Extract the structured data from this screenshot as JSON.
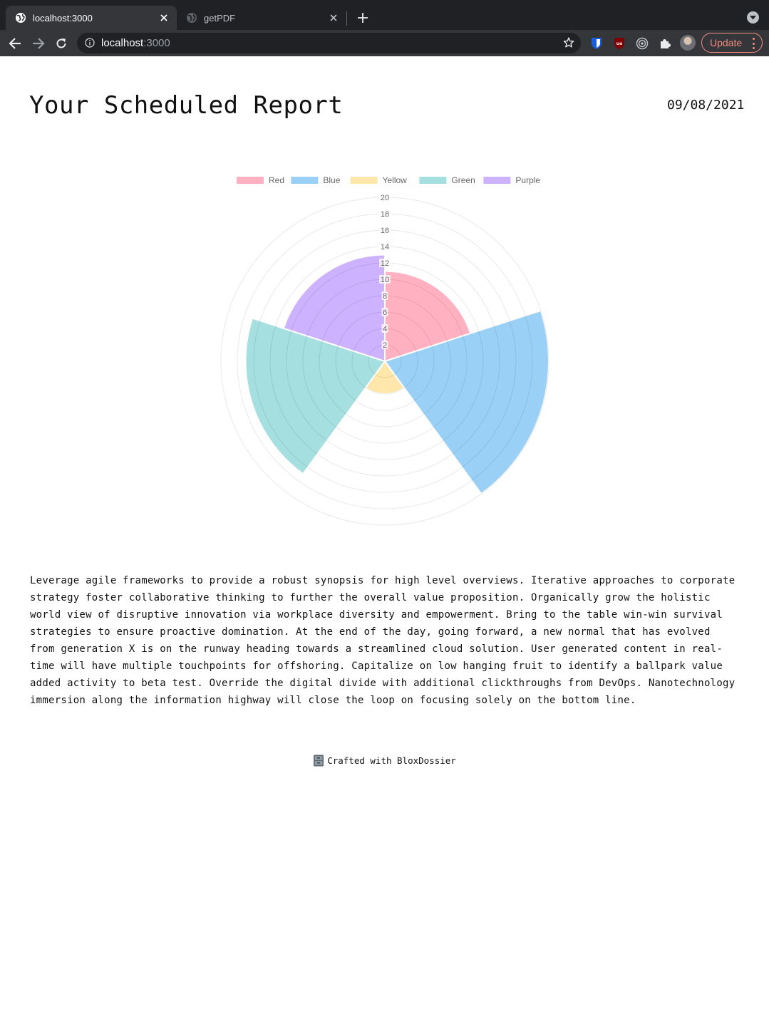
{
  "browser": {
    "tabs": [
      {
        "title": "localhost:3000",
        "active": true
      },
      {
        "title": "getPDF",
        "active": false
      }
    ],
    "url_host": "localhost",
    "url_port": ":3000",
    "update_label": "Update",
    "extensions": [
      "bitwarden-icon",
      "ublock-icon",
      "target-icon",
      "puzzle-icon"
    ]
  },
  "report": {
    "title": "Your Scheduled Report",
    "date": "09/08/2021",
    "body": "Leverage agile frameworks to provide a robust synopsis for high level overviews. Iterative approaches to corporate strategy foster collaborative thinking to further the overall value proposition. Organically grow the holistic world view of disruptive innovation via workplace diversity and empowerment. Bring to the table win-win survival strategies to ensure proactive domination. At the end of the day, going forward, a new normal that has evolved from generation X is on the runway heading towards a streamlined cloud solution. User generated content in real-time will have multiple touchpoints for offshoring. Capitalize on low hanging fruit to identify a ballpark value added activity to beta test. Override the digital divide with additional clickthroughs from DevOps. Nanotechnology immersion along the information highway will close the loop on focusing solely on the bottom line.",
    "footer": "Crafted with BloxDossier"
  },
  "chart_data": {
    "type": "polarArea",
    "categories": [
      "Red",
      "Blue",
      "Yellow",
      "Green",
      "Purple"
    ],
    "values": [
      11,
      20,
      4,
      17,
      13
    ],
    "colors": [
      "#ffb1c1",
      "#9ad0f5",
      "#ffe6aa",
      "#a5dfdf",
      "#ccb2ff"
    ],
    "r_ticks": [
      2,
      4,
      6,
      8,
      10,
      12,
      14,
      16,
      18,
      20
    ],
    "rlim": [
      0,
      20
    ],
    "legend_position": "top",
    "grid": true
  }
}
